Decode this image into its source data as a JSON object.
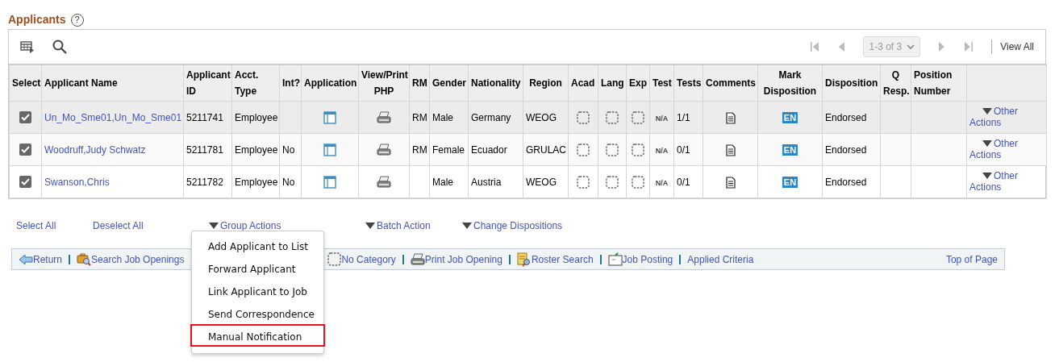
{
  "section": {
    "title": "Applicants",
    "help": "?"
  },
  "toolbar": {
    "pager": "1-3 of 3",
    "view_all": "View All"
  },
  "table": {
    "columns": [
      "Select",
      "Applicant Name",
      "Applicant ID",
      "Acct. Type",
      "Int?",
      "Application",
      "View/Print PHP",
      "RM",
      "Gender",
      "Nationality",
      "Region",
      "Acad",
      "Lang",
      "Exp",
      "Test",
      "Tests",
      "Comments",
      "Mark Disposition",
      "Disposition",
      "Q Resp.",
      "Position Number"
    ],
    "rows": [
      {
        "selected": true,
        "name": "Un_Mo_Sme01,Un_Mo_Sme01",
        "id": "5211741",
        "acct_type": "Employee",
        "rm": "RM",
        "gender": "Male",
        "nationality": "Germany",
        "region": "WEOG",
        "test": "N/A",
        "tests": "1/1",
        "mark": "EN",
        "disposition": "Endorsed",
        "other_actions": "Other Actions"
      },
      {
        "selected": true,
        "name": "Woodruff,Judy Schwatz",
        "id": "5211781",
        "acct_type": "Employee",
        "int": "No",
        "rm": "RM",
        "gender": "Female",
        "nationality": "Ecuador",
        "region": "GRULAC",
        "test": "N/A",
        "tests": "0/1",
        "mark": "EN",
        "disposition": "Endorsed",
        "other_actions": "Other Actions"
      },
      {
        "selected": true,
        "name": "Swanson,Chris",
        "id": "5211782",
        "acct_type": "Employee",
        "int": "No",
        "gender": "Male",
        "nationality": "Austria",
        "region": "WEOG",
        "test": "N/A",
        "tests": "0/1",
        "mark": "EN",
        "disposition": "Endorsed",
        "other_actions": "Other Actions"
      }
    ]
  },
  "actions": [
    {
      "label": "Select All",
      "kind": "link"
    },
    {
      "label": "Deselect All",
      "kind": "link"
    },
    {
      "label": "Group Actions",
      "kind": "menu"
    },
    {
      "label": "Batch Action",
      "kind": "menu"
    },
    {
      "label": "Change Dispositions",
      "kind": "menu"
    }
  ],
  "group_menu": {
    "items": [
      {
        "label": "Add Applicant to List",
        "selected": false
      },
      {
        "label": "Forward Applicant",
        "selected": false
      },
      {
        "label": "Link Applicant to Job",
        "selected": false
      },
      {
        "label": "Send Correspondence",
        "selected": false
      },
      {
        "label": "Manual Notification",
        "selected": true
      }
    ]
  },
  "footer": {
    "links": [
      {
        "label": "Return",
        "kind": "return"
      },
      {
        "label": "Search Job Openings",
        "kind": "search-openings"
      },
      {
        "label": "No Category",
        "kind": "category"
      },
      {
        "label": "Print Job Opening",
        "kind": "print"
      },
      {
        "label": "Roster Search",
        "kind": "roster"
      },
      {
        "label": "Job Posting",
        "kind": "posting"
      },
      {
        "label": "Applied Criteria",
        "kind": "plain"
      }
    ],
    "top_link": "Top of Page"
  }
}
